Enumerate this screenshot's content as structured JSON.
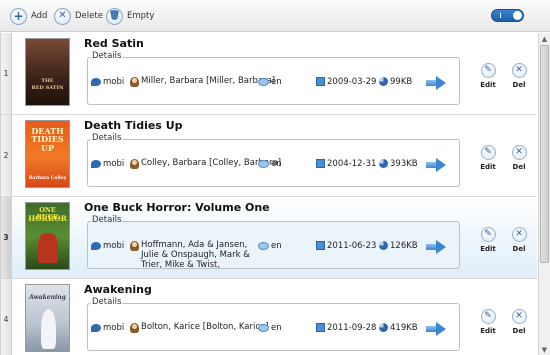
{
  "toolbar": {
    "add_label": "Add",
    "delete_label": "Delete",
    "empty_label": "Empty"
  },
  "details_label": "Details",
  "actions": {
    "edit_label": "Edit",
    "del_label": "Del"
  },
  "colors": {
    "accent": "#2d64a8",
    "selected_row": "#dfeefa",
    "toggle": "#2a70c0"
  },
  "books": [
    {
      "num": "1",
      "title": "Red Satin",
      "format": "mobi",
      "author": "Miller, Barbara [Miller, Barbara]",
      "language": "en",
      "date": "2009-03-29",
      "size": "99KB",
      "cover_line1": "THE",
      "cover_line2": "RED SATIN"
    },
    {
      "num": "2",
      "title": "Death Tidies Up",
      "format": "mobi",
      "author": "Colley, Barbara [Colley, Barbara]",
      "language": "en",
      "date": "2004-12-31",
      "size": "393KB",
      "cover_line1": "DEATH TIDIES UP",
      "cover_line2": "Barbara Colley"
    },
    {
      "num": "3",
      "title": "One Buck Horror: Volume One",
      "format": "mobi",
      "author": "Hoffmann, Ada & Jansen, Julie & Onspaugh, Mark & Trier, Mike & Twist,",
      "language": "en",
      "date": "2011-06-23",
      "size": "126KB",
      "cover_line1": "ONE BUCK",
      "cover_line2": "HORROR"
    },
    {
      "num": "4",
      "title": "Awakening",
      "format": "mobi",
      "author": "Bolton, Karice [Bolton, Karice]",
      "language": "en",
      "date": "2011-09-28",
      "size": "419KB",
      "cover_line1": "Awakening",
      "cover_line2": ""
    }
  ]
}
